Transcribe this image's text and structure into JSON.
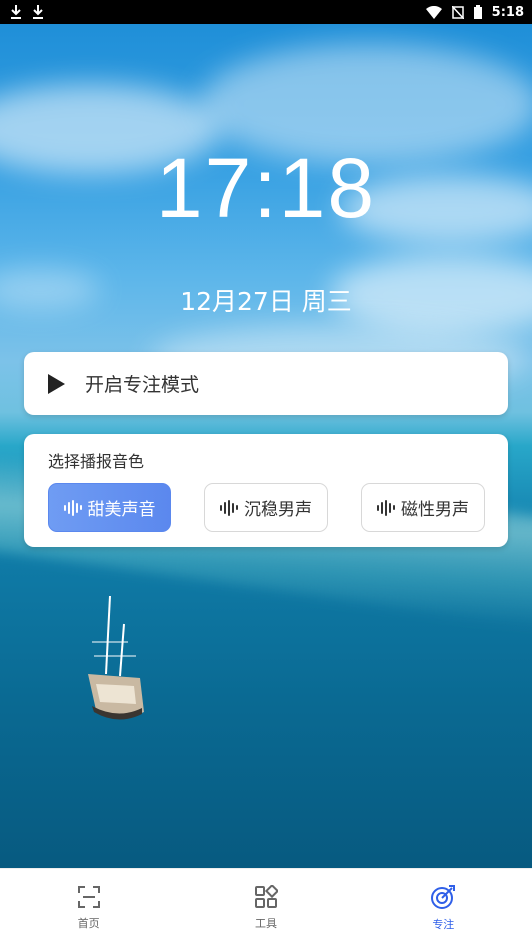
{
  "status_bar": {
    "time": "5:18"
  },
  "clock": {
    "time": "17:18",
    "date": "12月27日 周三"
  },
  "focus_card": {
    "label": "开启专注模式"
  },
  "voice_card": {
    "title": "选择播报音色",
    "options": [
      {
        "label": "甜美声音",
        "selected": true
      },
      {
        "label": "沉稳男声",
        "selected": false
      },
      {
        "label": "磁性男声",
        "selected": false
      }
    ]
  },
  "tabbar": {
    "tabs": [
      {
        "label": "首页",
        "icon": "scan-icon",
        "active": false
      },
      {
        "label": "工具",
        "icon": "apps-grid-icon",
        "active": false
      },
      {
        "label": "专注",
        "icon": "target-icon",
        "active": true
      }
    ]
  },
  "colors": {
    "accent": "#2f5fe8",
    "selected_button": "#5b88ee"
  }
}
